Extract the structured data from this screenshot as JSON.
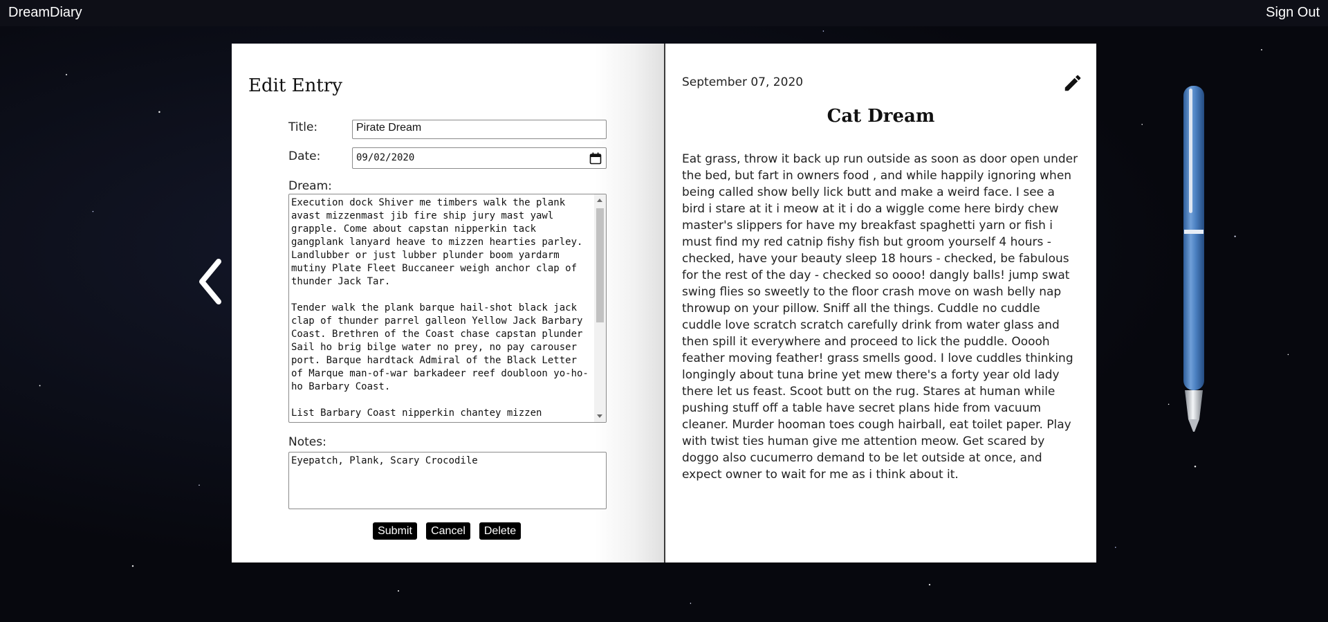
{
  "header": {
    "brand": "DreamDiary",
    "sign_out": "Sign Out"
  },
  "navigation": {
    "prev_icon": "chevron-left-icon"
  },
  "edit_form": {
    "heading": "Edit Entry",
    "title_label": "Title:",
    "title_value": "Pirate Dream",
    "date_label": "Date:",
    "date_value": "09/02/2020",
    "dream_label": "Dream:",
    "dream_value": "Execution dock Shiver me timbers walk the plank avast mizzenmast jib fire ship jury mast yawl grapple. Come about capstan nipperkin tack gangplank lanyard heave to mizzen hearties parley. Landlubber or just lubber plunder boom yardarm mutiny Plate Fleet Buccaneer weigh anchor clap of thunder Jack Tar.\n\nTender walk the plank barque hail-shot black jack clap of thunder parrel galleon Yellow Jack Barbary Coast. Brethren of the Coast chase capstan plunder Sail ho brig bilge water no prey, no pay carouser port. Barque hardtack Admiral of the Black Letter of Marque man-of-war barkadeer reef doubloon yo-ho-ho Barbary Coast.\n\nList Barbary Coast nipperkin chantey mizzen",
    "notes_label": "Notes:",
    "notes_value": "Eyepatch, Plank, Scary Crocodile",
    "submit_label": "Submit",
    "cancel_label": "Cancel",
    "delete_label": "Delete"
  },
  "entry": {
    "date": "September 07, 2020",
    "title": "Cat Dream",
    "body": "Eat grass, throw it back up run outside as soon as door open under the bed, but fart in owners food , and while happily ignoring when being called show belly lick butt and make a weird face. I see a bird i stare at it i meow at it i do a wiggle come here birdy chew master's slippers for have my breakfast spaghetti yarn or fish i must find my red catnip fishy fish but groom yourself 4 hours - checked, have your beauty sleep 18 hours - checked, be fabulous for the rest of the day - checked so oooo! dangly balls! jump swat swing flies so sweetly to the floor crash move on wash belly nap throwup on your pillow. Sniff all the things. Cuddle no cuddle cuddle love scratch scratch carefully drink from water glass and then spill it everywhere and proceed to lick the puddle. Ooooh feather moving feather! grass smells good. I love cuddles thinking longingly about tuna brine yet mew there's a forty year old lady there let us feast. Scoot butt on the rug. Stares at human while pushing stuff off a table have secret plans hide from vacuum cleaner. Murder hooman toes cough hairball, eat toilet paper. Play with twist ties human give me attention meow. Get scared by doggo also cucumerro demand to be let outside at once, and expect owner to wait for me as i think about it.",
    "edit_icon": "pencil-icon"
  },
  "decor": {
    "pen_icon": "pen-icon",
    "pen_color": "#4a7fc0"
  }
}
